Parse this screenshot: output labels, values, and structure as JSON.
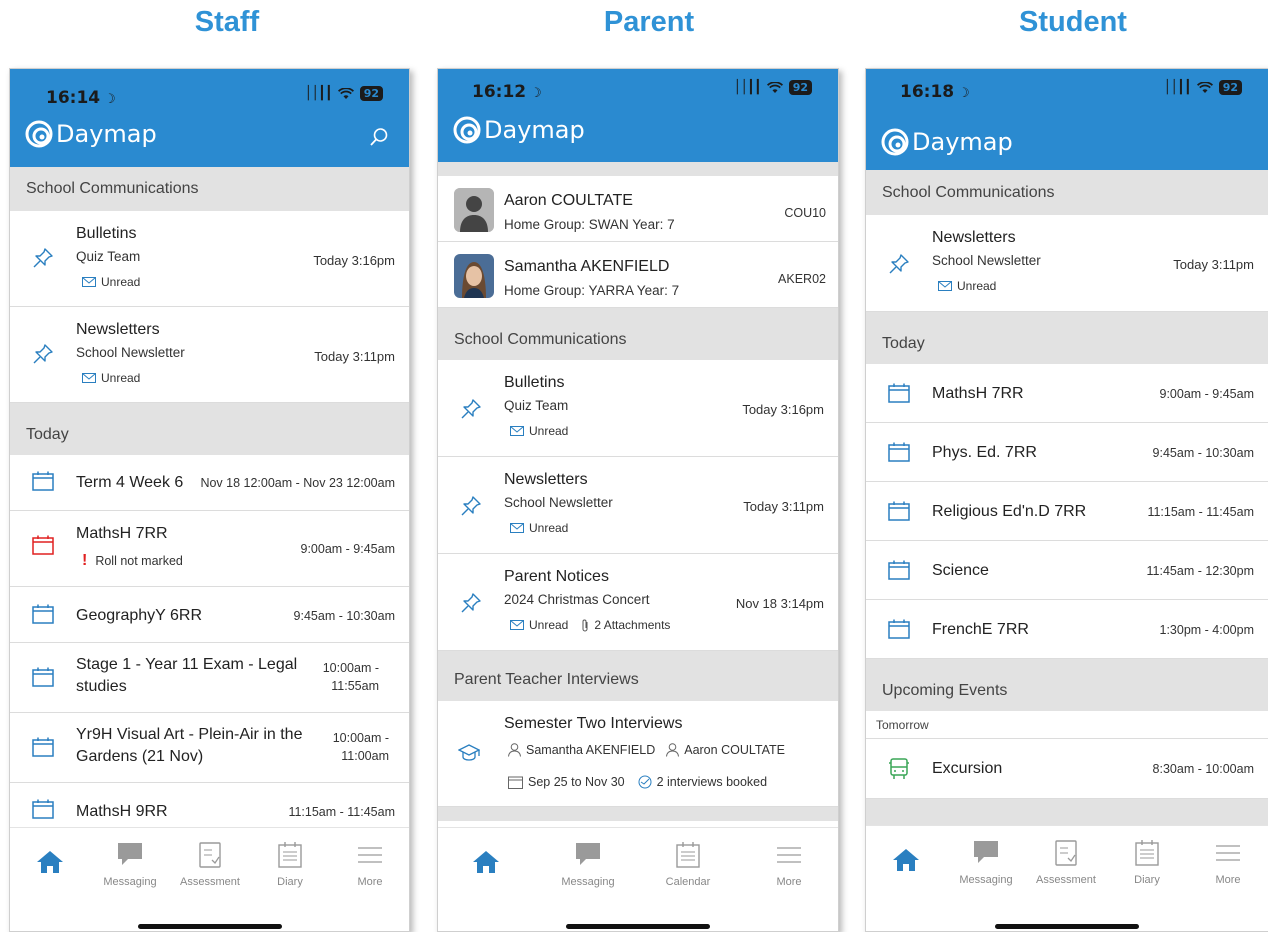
{
  "columns": {
    "staff": "Staff",
    "parent": "Parent",
    "student": "Student"
  },
  "brand": {
    "name": "Daymap"
  },
  "colors": {
    "header": "#2a8ad0",
    "accent": "#2f92d6",
    "alert": "#e02020",
    "event_green": "#3aa657"
  },
  "staff": {
    "time": "16:14",
    "battery": "92",
    "sections": {
      "comms": "School Communications",
      "today": "Today"
    },
    "comms": [
      {
        "title": "Bulletins",
        "sub": "Quiz Team",
        "status": "Unread",
        "time": "Today 3:16pm",
        "icon": "pin-icon"
      },
      {
        "title": "Newsletters",
        "sub": "School Newsletter",
        "status": "Unread",
        "time": "Today 3:11pm",
        "icon": "pin-icon"
      }
    ],
    "events": [
      {
        "title": "Term 4 Week 6",
        "time": "Nov 18 12:00am - Nov 23 12:00am"
      },
      {
        "title": "MathsH 7RR",
        "time": "9:00am - 9:45am",
        "note": "Roll not marked",
        "note_mark": "!"
      },
      {
        "title": "GeographyY 6RR",
        "time": "9:45am - 10:30am"
      },
      {
        "title_l1": "Stage 1 - Year 11 Exam - Legal",
        "title_l2": "studies",
        "time_l1": "10:00am -",
        "time_l2": "11:55am"
      },
      {
        "title_l1": "Yr9H Visual Art - Plein-Air in the",
        "title_l2": "Gardens (21 Nov)",
        "time_l1": "10:00am -",
        "time_l2": "11:00am"
      },
      {
        "title": "MathsH 9RR",
        "time": "11:15am - 11:45am"
      }
    ],
    "tabs": [
      "Messaging",
      "Assessment",
      "Diary",
      "More"
    ]
  },
  "parent": {
    "time": "16:12",
    "battery": "92",
    "students": [
      {
        "name": "Aaron COULTATE",
        "group": "Home Group: SWAN Year: 7",
        "code": "COU10"
      },
      {
        "name": "Samantha AKENFIELD",
        "group": "Home Group: YARRA Year: 7",
        "code": "AKER02"
      }
    ],
    "sections": {
      "comms": "School Communications",
      "pti": "Parent Teacher Interviews"
    },
    "comms": [
      {
        "title": "Bulletins",
        "sub": "Quiz Team",
        "status": "Unread",
        "time": "Today 3:16pm"
      },
      {
        "title": "Newsletters",
        "sub": "School Newsletter",
        "status": "Unread",
        "time": "Today 3:11pm"
      },
      {
        "title": "Parent Notices",
        "sub": "2024 Christmas Concert",
        "status": "Unread",
        "attachments": "2 Attachments",
        "time": "Nov 18 3:14pm"
      }
    ],
    "interview": {
      "title": "Semester Two Interviews",
      "person1": "Samantha AKENFIELD",
      "person2": "Aaron COULTATE",
      "dates": "Sep 25 to Nov 30",
      "booked": "2 interviews booked"
    },
    "tabs": [
      "Messaging",
      "Calendar",
      "More"
    ]
  },
  "student": {
    "time": "16:18",
    "battery": "92",
    "sections": {
      "comms": "School Communications",
      "today": "Today",
      "upcoming": "Upcoming Events",
      "tomorrow": "Tomorrow"
    },
    "comms": [
      {
        "title": "Newsletters",
        "sub": "School Newsletter",
        "status": "Unread",
        "time": "Today 3:11pm"
      }
    ],
    "events": [
      {
        "title": "MathsH 7RR",
        "time": "9:00am - 9:45am"
      },
      {
        "title": "Phys. Ed. 7RR",
        "time": "9:45am - 10:30am"
      },
      {
        "title": "Religious Ed'n.D 7RR",
        "time": "11:15am - 11:45am"
      },
      {
        "title": "Science",
        "time": "11:45am - 12:30pm"
      },
      {
        "title": "FrenchE 7RR",
        "time": "1:30pm - 4:00pm"
      }
    ],
    "upcoming": [
      {
        "title": "Excursion",
        "time": "8:30am - 10:00am"
      }
    ],
    "tabs": [
      "Messaging",
      "Assessment",
      "Diary",
      "More"
    ]
  }
}
